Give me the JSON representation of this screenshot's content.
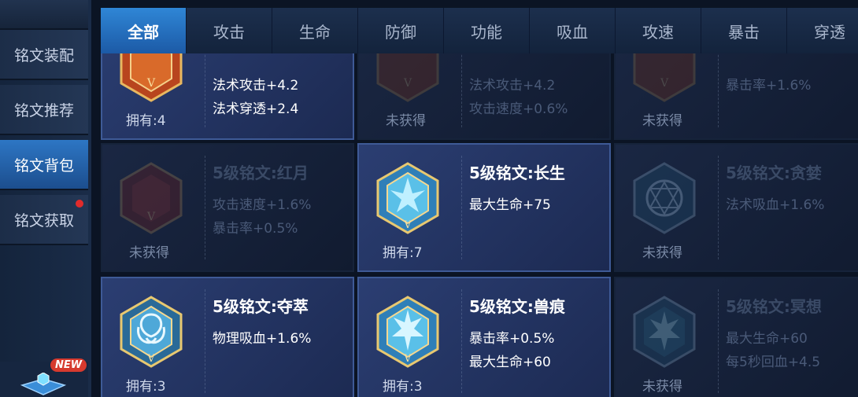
{
  "sidebar": {
    "items": [
      {
        "label": "铭文装配"
      },
      {
        "label": "铭文推荐"
      },
      {
        "label": "铭文背包"
      },
      {
        "label": "铭文获取"
      }
    ],
    "new_badge": "NEW"
  },
  "tabs": [
    "全部",
    "攻击",
    "生命",
    "防御",
    "功能",
    "吸血",
    "攻速",
    "暴击",
    "穿透"
  ],
  "cards": [
    {
      "name": "",
      "stats": [
        "法术攻击+4.2",
        "法术穿透+2.4"
      ],
      "status": "拥有:4"
    },
    {
      "name": "",
      "stats": [
        "法术攻击+4.2",
        "攻击速度+0.6%"
      ],
      "status": "未获得"
    },
    {
      "name": "",
      "stats": [
        "暴击率+1.6%"
      ],
      "status": "未获得"
    },
    {
      "name": "5级铭文:红月",
      "stats": [
        "攻击速度+1.6%",
        "暴击率+0.5%"
      ],
      "status": "未获得"
    },
    {
      "name": "5级铭文:长生",
      "stats": [
        "最大生命+75"
      ],
      "status": "拥有:7"
    },
    {
      "name": "5级铭文:贪婪",
      "stats": [
        "法术吸血+1.6%"
      ],
      "status": "未获得"
    },
    {
      "name": "5级铭文:夺萃",
      "stats": [
        "物理吸血+1.6%"
      ],
      "status": "拥有:3"
    },
    {
      "name": "5级铭文:兽痕",
      "stats": [
        "暴击率+0.5%",
        "最大生命+60"
      ],
      "status": "拥有:3"
    },
    {
      "name": "5级铭文:冥想",
      "stats": [
        "最大生命+60",
        "每5秒回血+4.5"
      ],
      "status": "未获得"
    }
  ]
}
